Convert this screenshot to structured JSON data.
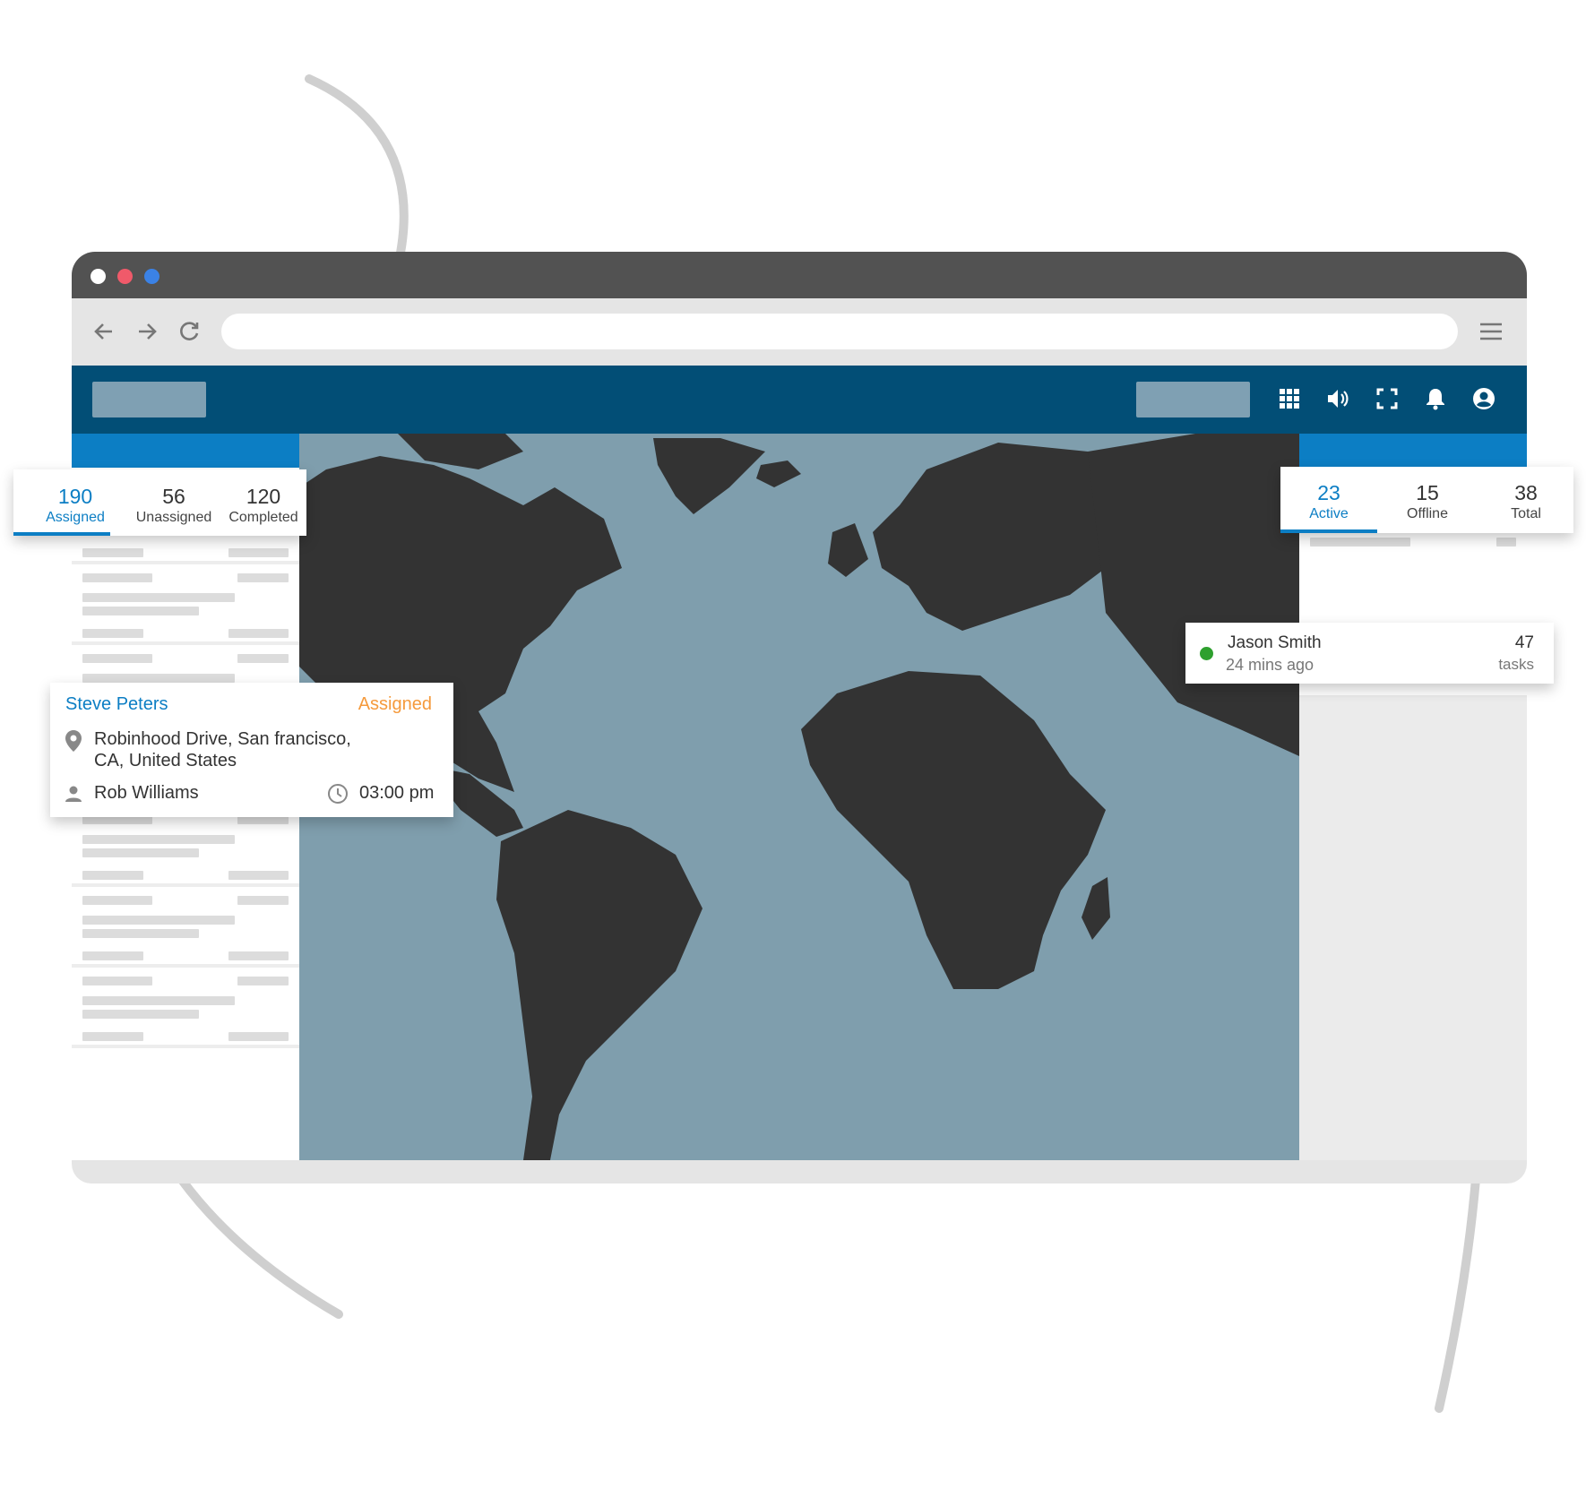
{
  "browser": {
    "window_dots": [
      {
        "name": "close",
        "color": "#ffffff"
      },
      {
        "name": "minimize",
        "color": "#f05a6a"
      },
      {
        "name": "maximize",
        "color": "#3b82e6"
      }
    ],
    "nav_icons": [
      "arrow-left-icon",
      "arrow-right-icon",
      "reload-icon",
      "menu-icon"
    ],
    "url": ""
  },
  "header": {
    "icons": [
      "apps-grid-icon",
      "volume-icon",
      "fullscreen-icon",
      "bell-icon",
      "account-icon"
    ],
    "brand_color": "#024e76"
  },
  "task_tabs": [
    {
      "count": "190",
      "label": "Assigned",
      "active": true
    },
    {
      "count": "56",
      "label": "Unassigned",
      "active": false
    },
    {
      "count": "120",
      "label": "Completed",
      "active": false
    }
  ],
  "agent_tabs": [
    {
      "count": "23",
      "label": "Active",
      "active": true
    },
    {
      "count": "15",
      "label": "Offline",
      "active": false
    },
    {
      "count": "38",
      "label": "Total",
      "active": false
    }
  ],
  "task_card": {
    "name": "Steve Peters",
    "status": "Assigned",
    "address_line1": "Robinhood Drive, San francisco,",
    "address_line2": "CA, United States",
    "agent": "Rob Williams",
    "time": "03:00 pm"
  },
  "agent_card": {
    "name": "Jason Smith",
    "last_seen": "24 mins ago",
    "task_count": "47",
    "task_label": "tasks",
    "status_color": "#2ea02e"
  },
  "colors": {
    "accent": "#0c7ec4",
    "status_assigned": "#f59a3c",
    "map_water": "#7f9ead",
    "map_land": "#333333"
  }
}
